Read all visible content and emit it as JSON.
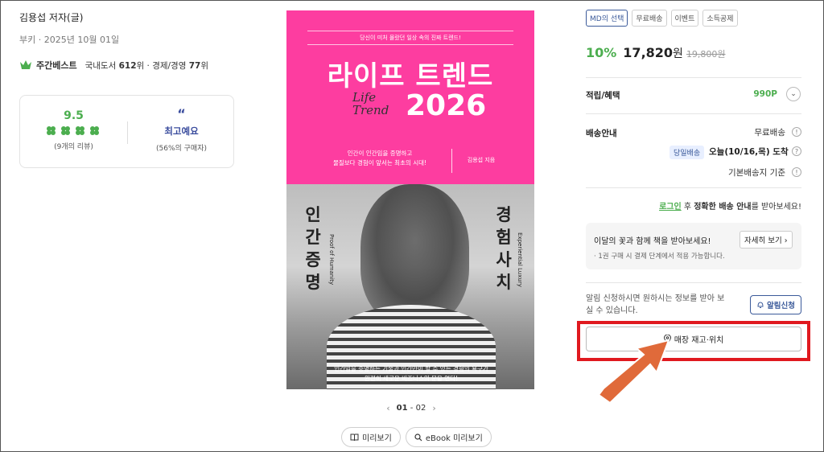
{
  "product": {
    "author": "김용섭 저자(글)",
    "publisher_date": "부키 · 2025년 10월 01일",
    "bestseller": {
      "title": "주간베스트",
      "rank_prefix": "국내도서",
      "rank_main": "612",
      "rank_mid": "위 · 경제/경영",
      "rank_sub": "77",
      "rank_suffix": "위"
    },
    "review": {
      "score": "9.5",
      "count_text": "(9개의 리뷰)",
      "quote_mark": "“",
      "best_label": "최고예요",
      "best_pct": "(56%의 구매자)"
    }
  },
  "cover": {
    "tagline": "당신이 미처 몰랐던 일상 속의 진짜 트렌드!",
    "title": "라이프 트렌드",
    "script": "Life\nTrend",
    "year": "2026",
    "sub": "인간이 인간임을 증명하고\n물질보다 경험이 앞서는 최초의 시대!",
    "author": "김용섭 지음",
    "v_left": "인간증명",
    "v_left_en": "Proof of Humanity",
    "v_right": "경험사치",
    "v_right_en": "Experiential Luxury",
    "desc": "인간임을 증명하는 기술과 인간만이 할 수 있는 경험의 욕구가\n완전히 새로운 비즈니스의 문을 연다!"
  },
  "pager": {
    "prev": "‹",
    "current": "01",
    "sep": "-",
    "total": "02",
    "next": "›"
  },
  "preview_buttons": [
    {
      "icon": "book-icon",
      "label": "미리보기"
    },
    {
      "icon": "search-icon",
      "label": "eBook 미리보기"
    }
  ],
  "badges": [
    "MD의 선택",
    "무료배송",
    "이벤트",
    "소득공제"
  ],
  "price": {
    "discount": "10%",
    "amount": "17,820",
    "won": "원",
    "original": "19,800원"
  },
  "points": {
    "label": "적립/혜택",
    "value": "990P",
    "toggle": "⌄"
  },
  "delivery": {
    "label": "배송안내",
    "free": "무료배송",
    "sameday": "당일배송",
    "date": "오늘(10/16,목) 도착",
    "base": "기본배송지 기준",
    "info": "!",
    "question": "?"
  },
  "login_notice": {
    "link": "로그인",
    "mid": " 후 ",
    "bold": "정확한 배송 안내",
    "tail": "를 받아보세요!"
  },
  "flower": {
    "title": "이달의 꽃과 함께 책을 받아보세요!",
    "button": "자세히 보기 ›",
    "sub": "· 1권 구매 시 결제 단계에서 적용 가능합니다."
  },
  "notify": {
    "text": "알림 신청하시면 원하시는 정보를 받아 보실 수 있습니다.",
    "button": "알림신청"
  },
  "store": {
    "label": "매장 재고·위치"
  },
  "colors": {
    "green": "#4cae4f",
    "navy": "#3b5a9a",
    "cover_pink": "#fd3da0",
    "highlight_red": "#e0191f",
    "arrow_orange": "#e06a3a"
  }
}
